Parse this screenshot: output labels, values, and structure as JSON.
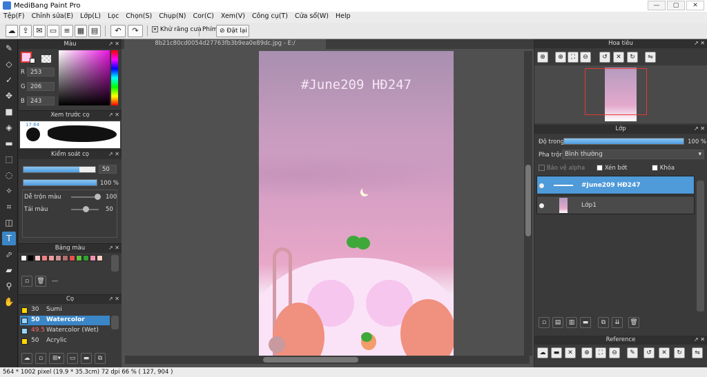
{
  "window": {
    "title": "MediBang Paint Pro",
    "controls": [
      "—",
      "▢",
      "✕"
    ]
  },
  "menu": [
    "Tệp(F)",
    "Chỉnh sửa(E)",
    "Lớp(L)",
    "Lọc",
    "Chọn(S)",
    "Chụp(N)",
    "Cor(C)",
    "Xem(V)",
    "Công cụ(T)",
    "Cửa sổ(W)",
    "Help"
  ],
  "toolbar": {
    "antialias_label": "Khử răng cưa",
    "antialias_checked": true,
    "keys_label": "Phím",
    "reset_label": "Đặt lại"
  },
  "color_panel": {
    "title": "Màu",
    "r_label": "R",
    "g_label": "G",
    "b_label": "B",
    "r": "253",
    "g": "206",
    "b": "243",
    "fg": "#fdcef3"
  },
  "brush_preview": {
    "title": "Xem trước cọ",
    "size_text": "17.64"
  },
  "brush_control": {
    "title": "Kiểm soát cọ",
    "size": "50",
    "opacity": "100 %",
    "size_fraction": 0.78,
    "opacity_fraction": 1.0,
    "mix_label": "Dễ trộn màu",
    "mix_value": "100",
    "load_label": "Tải màu",
    "load_value": "50"
  },
  "palette": {
    "title": "Bảng màu",
    "swatches": [
      "#ffffff",
      "#000000",
      "#f8c8c8",
      "#f08080",
      "#e8a0a0",
      "#d09090",
      "#b07070",
      "#e85050",
      "#60c040",
      "#30a030",
      "#f090b0",
      "#ffd0c0"
    ],
    "page_text": "---"
  },
  "brushes": {
    "title": "Cọ",
    "items": [
      {
        "num": "30",
        "name": "Sumi",
        "color": "#ffd800"
      },
      {
        "num": "50",
        "name": "Watercolor",
        "color": "#1e90ff"
      },
      {
        "num": "49.5",
        "name": "Watercolor (Wet)",
        "color": "#1e90ff"
      },
      {
        "num": "50",
        "name": "Acrylic",
        "color": "#ffd800"
      }
    ]
  },
  "canvas": {
    "tab": "8b21c80cd0054d27763fb3b9ea0e89dc.jpg - E:/",
    "art_text": "#June209 HĐ247"
  },
  "navigator": {
    "title": "Hoa tiêu"
  },
  "layers": {
    "title": "Lớp",
    "opacity_label": "Độ trong",
    "opacity_value": "100 %",
    "blend_label": "Pha trộn",
    "blend_value": "Bình thường",
    "alpha_label": "Bảo vệ alpha",
    "clip_label": "Xén bớt",
    "lock_label": "Khóa",
    "items": [
      {
        "name": "#June209 HĐ247"
      },
      {
        "name": "Lớp1"
      }
    ]
  },
  "reference": {
    "title": "Reference"
  },
  "status": {
    "text": "564 * 1002 pixel   (19.9 * 35.3cm)   72 dpi   66 %   ( 127, 904 )"
  }
}
